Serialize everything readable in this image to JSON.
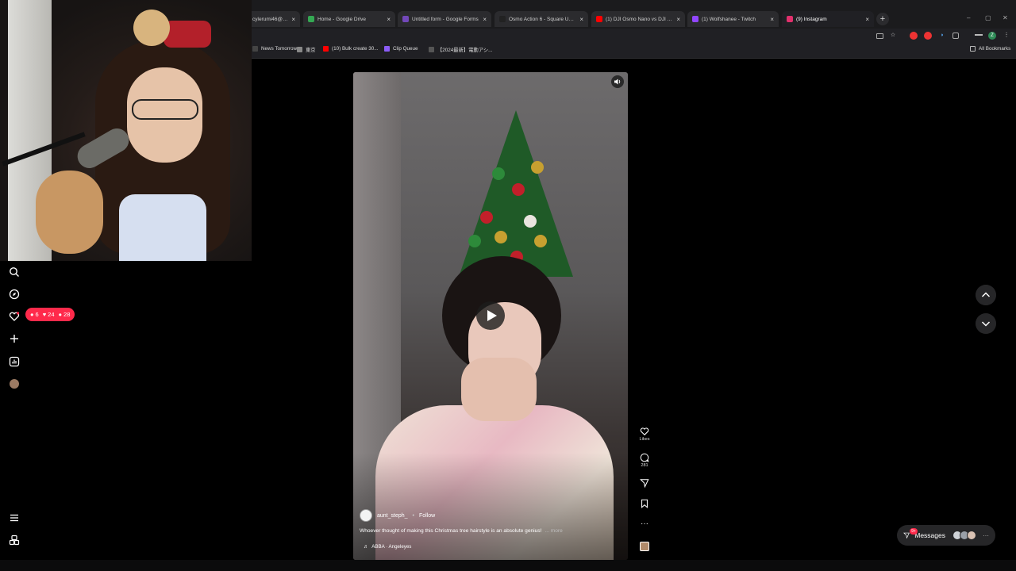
{
  "browser": {
    "tabs": [
      {
        "title": "cylerumi46@gm",
        "color": "#4285f4"
      },
      {
        "title": "Home - Google Drive",
        "color": "#34a853"
      },
      {
        "title": "Untitled form - Google Forms",
        "color": "#7248b9"
      },
      {
        "title": "Osmo Action 6 - Square Up, N",
        "color": "#222222"
      },
      {
        "title": "(1) DJI Osmo Nano vs DJI Actio",
        "color": "#ff0000"
      },
      {
        "title": "(1) Wolfshanee - Twitch",
        "color": "#9146ff"
      },
      {
        "title": "(9) Instagram",
        "color": "#e1306c"
      }
    ],
    "new_tab": "+",
    "window_controls": [
      "–",
      "▢",
      "✕"
    ],
    "profile_initial": "Z",
    "bookmarks": [
      {
        "label": "News Tomorrow",
        "color": "#444444"
      },
      {
        "label": "東京",
        "color": "#888888"
      },
      {
        "label": "(10) Bulk create 30...",
        "color": "#ff0000"
      },
      {
        "label": "Clip Queue",
        "color": "#8b5cf6"
      },
      {
        "label": "【2024最新】電動アシ...",
        "color": "#555555"
      }
    ],
    "all_bookmarks": "All Bookmarks"
  },
  "sidebar": {
    "icons": [
      "search-icon",
      "explore-icon",
      "notifications-icon",
      "create-icon",
      "insights-icon",
      "profile-avatar"
    ],
    "notifications": {
      "comments": "6",
      "likes": "24",
      "follows": "28"
    },
    "menu_icon": "menu-icon",
    "threads_icon": "threads-icon"
  },
  "reel": {
    "username": "aunt_steph_",
    "follow_label": "Follow",
    "caption": "Whoever thought of making this Christmas tree hairstyle is an absolute genius!",
    "more_label": "... more",
    "music": "ABBA · Angeleyes",
    "likes_label": "Likes",
    "comments_count": "281"
  },
  "messages": {
    "label": "Messages",
    "badge": "9+",
    "more": "···"
  },
  "colors": {
    "accent_red": "#ff2a4b",
    "background": "#000000"
  }
}
